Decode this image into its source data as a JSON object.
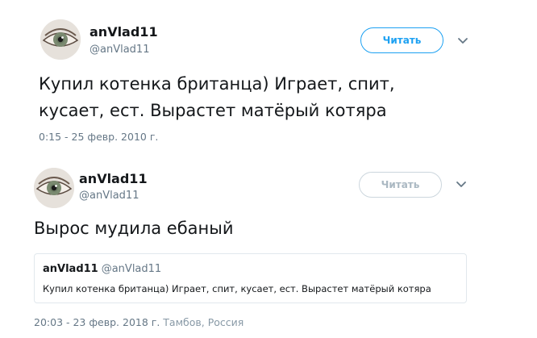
{
  "tweets": [
    {
      "author_name": "anVlad11",
      "author_handle": "@anVlad11",
      "follow_label": "Читать",
      "text_lines": [
        "Купил котенка британца) Играет, спит,",
        "кусает, ест. Вырастет матёрый котяра"
      ],
      "timestamp": "0:15 - 25 февр. 2010 г."
    },
    {
      "author_name": "anVlad11",
      "author_handle": "@anVlad11",
      "follow_label": "Читать",
      "text": "Вырос мудила ебаный",
      "quoted": {
        "author_name": "anVlad11",
        "author_handle": "@anVlad11",
        "text": "Купил котенка британца) Играет, спит, кусает, ест. Вырастет матёрый котяра"
      },
      "timestamp": "20:03 - 23 февр. 2018 г.",
      "location": "Тамбов, Россия"
    }
  ],
  "colors": {
    "accent": "#1da1f2",
    "text": "#14171a",
    "secondary": "#657786",
    "muted_border": "#ccd6dd"
  },
  "icons": {
    "avatar": "eye-photo",
    "more": "chevron-down-icon"
  }
}
